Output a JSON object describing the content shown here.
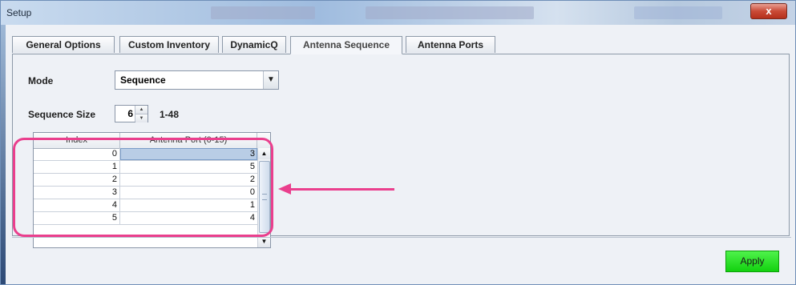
{
  "window": {
    "title": "Setup",
    "close_label": "x"
  },
  "tabs": [
    {
      "label": "General Options"
    },
    {
      "label": "Custom Inventory"
    },
    {
      "label": "DynamicQ"
    },
    {
      "label": "Antenna Sequence",
      "active": true
    },
    {
      "label": "Antenna Ports"
    }
  ],
  "form": {
    "mode_label": "Mode",
    "mode_value": "Sequence",
    "sequence_size_label": "Sequence Size",
    "sequence_size_value": "6",
    "sequence_size_range": "1-48"
  },
  "table": {
    "headers": [
      "Index",
      "Antenna Port (0-15)"
    ],
    "rows": [
      {
        "index": "0",
        "port": "3",
        "selected": true
      },
      {
        "index": "1",
        "port": "5"
      },
      {
        "index": "2",
        "port": "2"
      },
      {
        "index": "3",
        "port": "0"
      },
      {
        "index": "4",
        "port": "1"
      },
      {
        "index": "5",
        "port": "4"
      }
    ]
  },
  "footer": {
    "apply_label": "Apply"
  },
  "colors": {
    "annotation": "#ea3f8d",
    "apply_button": "#26dd22",
    "selected_row": "#b9cde6"
  },
  "icons": {
    "combo_arrow": "chevron-down-icon",
    "spin_up": "spin-up-icon",
    "spin_down": "spin-down-icon",
    "scroll_up": "scroll-up-icon",
    "scroll_down": "scroll-down-icon"
  }
}
